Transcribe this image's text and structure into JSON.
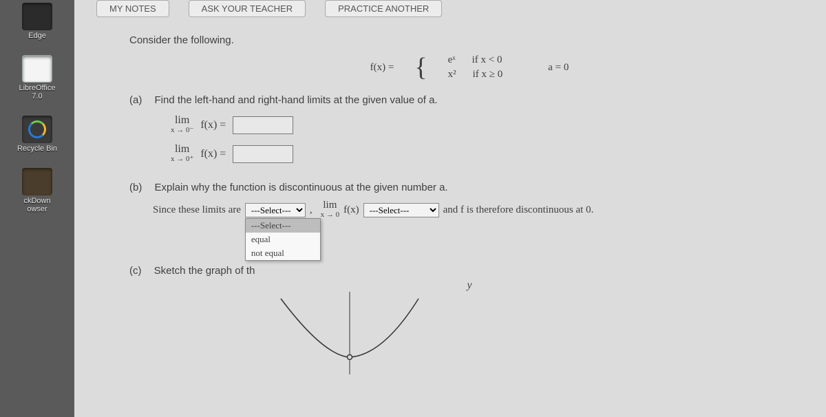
{
  "desktop": {
    "edge": "Edge",
    "libre": "LibreOffice\n7.0",
    "bin": "Recycle Bin",
    "kdown": "ckDown\nowser"
  },
  "topbar": {
    "notes": "MY NOTES",
    "ask": "ASK YOUR TEACHER",
    "practice": "PRACTICE ANOTHER"
  },
  "prompt": "Consider the following.",
  "piecewise": {
    "lhs": "f(x)  =",
    "r1a": "eˣ",
    "r1b": "if x < 0",
    "r2a": "x²",
    "r2b": "if x ≥ 0",
    "a": "a = 0"
  },
  "qa": {
    "tag": "(a)",
    "text": "Find the left-hand and right-hand limits at the given value of a."
  },
  "lim1": {
    "lim": "lim",
    "sub": "x → 0⁻",
    "fx": "f(x)  ="
  },
  "lim2": {
    "lim": "lim",
    "sub": "x → 0⁺",
    "fx": "f(x)  ="
  },
  "qb": {
    "tag": "(b)",
    "text": "Explain why the function is discontinuous at the given number a."
  },
  "sentence": {
    "p1": "Since these limits are",
    "sel1_current": "---Select---",
    "sel1_options": [
      "---Select---",
      "equal",
      "not equal"
    ],
    "comma": ",",
    "lim": "lim",
    "sub": "x → 0",
    "fx": "f(x)",
    "sel2_current": "---Select---",
    "p2": "and f is therefore discontinuous at 0."
  },
  "qc": {
    "tag": "(c)",
    "text": "Sketch the graph of th"
  },
  "axis_y": "y"
}
